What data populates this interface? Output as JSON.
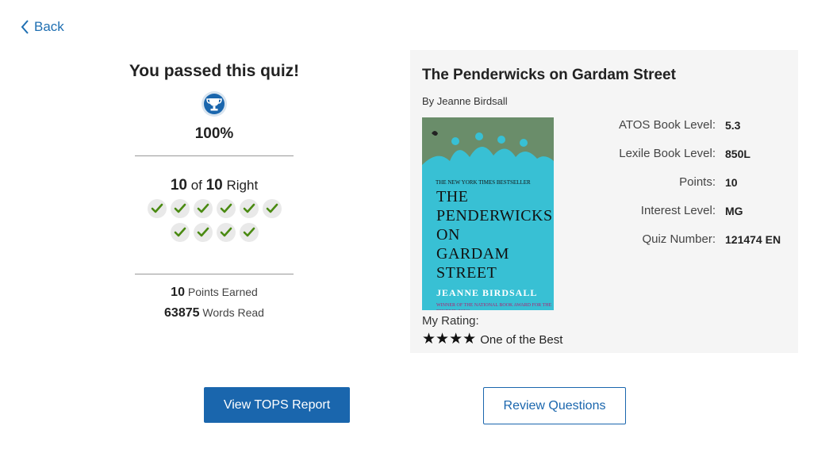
{
  "nav": {
    "back_label": "Back"
  },
  "result": {
    "title": "You passed this quiz!",
    "percent": "100%",
    "correct": "10",
    "of_word": "of",
    "total": "10",
    "right_word": "Right",
    "checks_count": 10,
    "points": "10",
    "points_label": "Points Earned",
    "words": "63875",
    "words_label": "Words Read"
  },
  "book": {
    "title": "The Penderwicks on Gardam Street",
    "author_line": "By Jeanne Birdsall",
    "cover": {
      "nyt": "THE NEW YORK TIMES BESTSELLER",
      "title_lines": [
        "THE",
        "PENDERWICKS",
        "ON",
        "GARDAM",
        "STREET"
      ],
      "author": "JEANNE BIRDSALL",
      "award": "WINNER OF THE NATIONAL BOOK AWARD FOR THE PENDERWICKS"
    },
    "meta": [
      {
        "label": "ATOS Book Level:",
        "value": "5.3"
      },
      {
        "label": "Lexile Book Level:",
        "value": "850L"
      },
      {
        "label": "Points:",
        "value": "10"
      },
      {
        "label": "Interest Level:",
        "value": "MG"
      },
      {
        "label": "Quiz Number:",
        "value": "121474 EN"
      }
    ],
    "rating_label": "My Rating:",
    "rating_stars": 4,
    "rating_text": "One of the Best"
  },
  "buttons": {
    "tops_report": "View TOPS Report",
    "review_questions": "Review Questions"
  },
  "colors": {
    "accent": "#1a66ad",
    "check": "#4a8a12"
  }
}
